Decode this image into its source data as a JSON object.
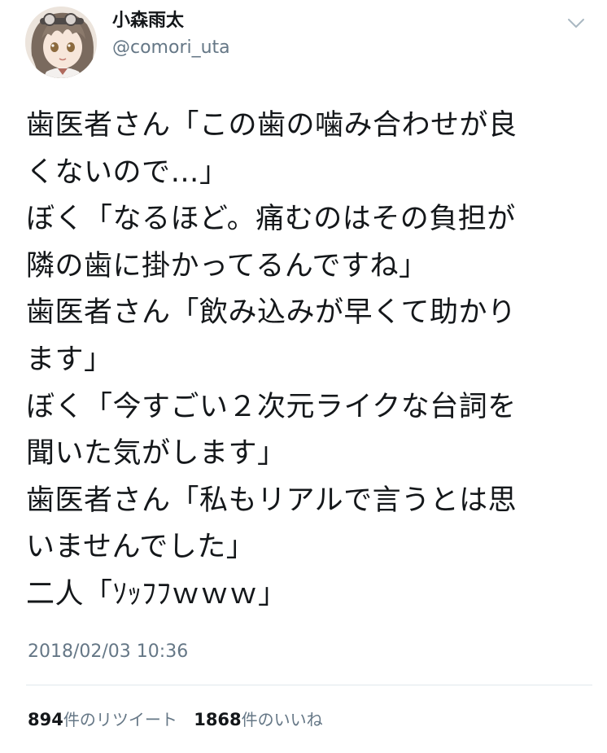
{
  "author": {
    "display_name": "小森雨太",
    "handle": "@comori_uta",
    "avatar_icon": "anime-character-avatar"
  },
  "menu": {
    "icon": "chevron-down-icon"
  },
  "tweet": {
    "lines": [
      "歯医者さん「この歯の噛み合わせが良",
      "くないので…」",
      "ぼく「なるほど。痛むのはその負担が",
      "隣の歯に掛かってるんですね」",
      "歯医者さん「飲み込みが早くて助かり",
      "ます」",
      "ぼく「今すごい２次元ライクな台詞を",
      "聞いた気がします」",
      "歯医者さん「私もリアルで言うとは思",
      "いませんでした」",
      "二人「ｿｯﾌﾌｗｗｗ」"
    ],
    "timestamp": "2018/02/03 10:36"
  },
  "stats": {
    "retweets": {
      "count": "894",
      "label": "件のリツイート"
    },
    "likes": {
      "count": "1868",
      "label": "件のいいね"
    }
  },
  "colors": {
    "text": "#14171a",
    "secondary": "#657786",
    "divider": "#e1e8ed",
    "background": "#ffffff"
  }
}
